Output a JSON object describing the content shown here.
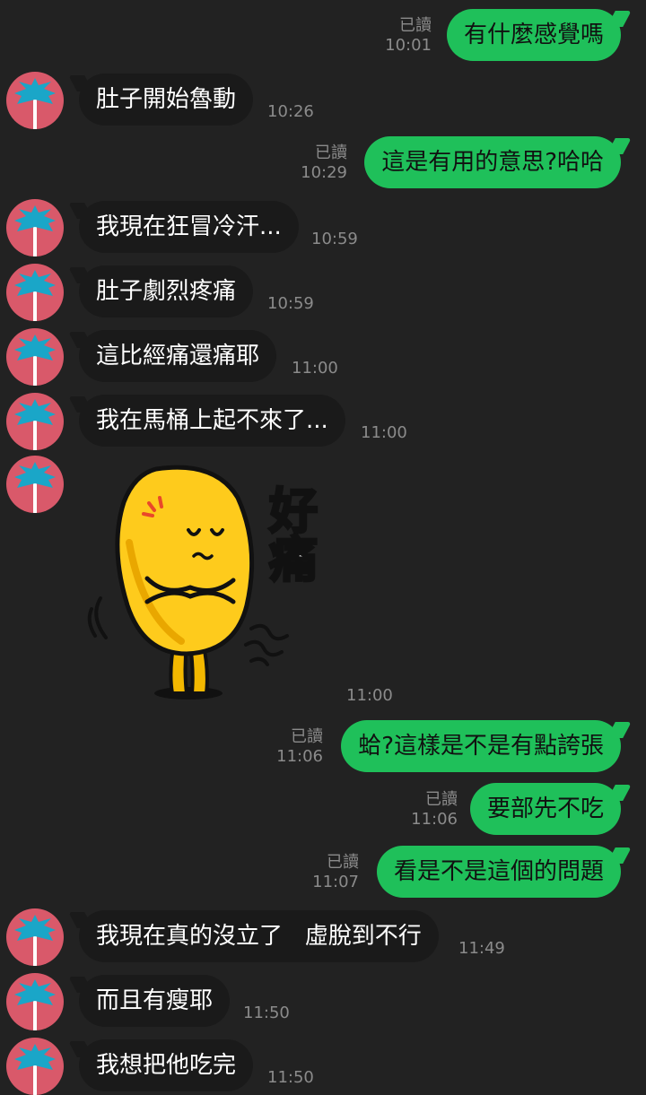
{
  "chat": {
    "messages": [
      {
        "side": "out",
        "text": "有什麼感覺嗎",
        "read": "已讀",
        "time": "10:01"
      },
      {
        "side": "in",
        "text": "肚子開始魯動",
        "time": "10:26"
      },
      {
        "side": "out",
        "text": "這是有用的意思?哈哈",
        "read": "已讀",
        "time": "10:29"
      },
      {
        "side": "in",
        "text": "我現在狂冒冷汗...",
        "time": "10:59"
      },
      {
        "side": "in",
        "text": "肚子劇烈疼痛",
        "time": "10:59"
      },
      {
        "side": "in",
        "text": "這比經痛還痛耶",
        "time": "11:00"
      },
      {
        "side": "in",
        "text": "我在馬桶上起不來了...",
        "time": "11:00"
      },
      {
        "side": "in",
        "type": "sticker",
        "sticker_text": "好痛",
        "time": "11:00"
      },
      {
        "side": "out",
        "text": "蛤?這樣是不是有點誇張",
        "read": "已讀",
        "time": "11:06"
      },
      {
        "side": "out",
        "text": "要部先不吃",
        "read": "已讀",
        "time": "11:06"
      },
      {
        "side": "out",
        "text": "看是不是這個的問題",
        "read": "已讀",
        "time": "11:07"
      },
      {
        "side": "in",
        "text": "我現在真的沒立了   虛脫到不行",
        "time": "11:49"
      },
      {
        "side": "in",
        "text": "而且有瘦耶",
        "time": "11:50"
      },
      {
        "side": "in",
        "text": "我想把他吃完",
        "time": "11:50"
      }
    ]
  },
  "colors": {
    "background": "#222222",
    "incoming_bubble": "#1a1a1a",
    "outgoing_bubble": "#1fc05a",
    "avatar_bg": "#d9596a",
    "timestamp": "#8b8b8b"
  },
  "icons": {
    "avatar": "palm-tree-icon",
    "sticker": "yellow-bean-pain-sticker"
  }
}
